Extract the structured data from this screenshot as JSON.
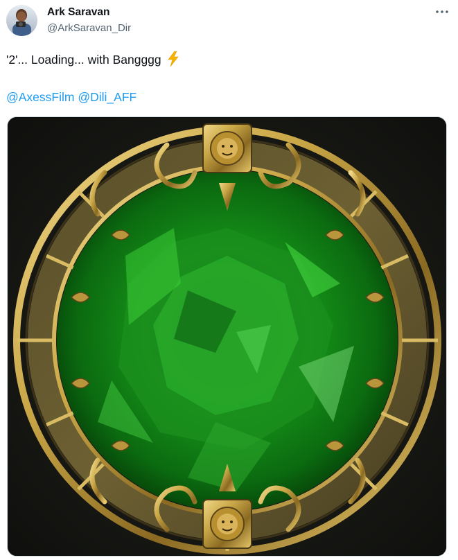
{
  "author": {
    "display_name": "Ark Saravan",
    "handle": "@ArkSaravan_Dir"
  },
  "tweet": {
    "text": "'2'... Loading... with Bangggg",
    "emoji": "high-voltage-icon",
    "mentions": [
      "@AxessFilm",
      "@Dili_AFF"
    ]
  },
  "media": {
    "description_icon": "emerald-in-golden-zodiac-ring-image"
  },
  "colors": {
    "link": "#1d9bf0",
    "text": "#0f1419",
    "secondary": "#536471",
    "gold": "#c9a646",
    "emerald": "#1fa82a"
  }
}
